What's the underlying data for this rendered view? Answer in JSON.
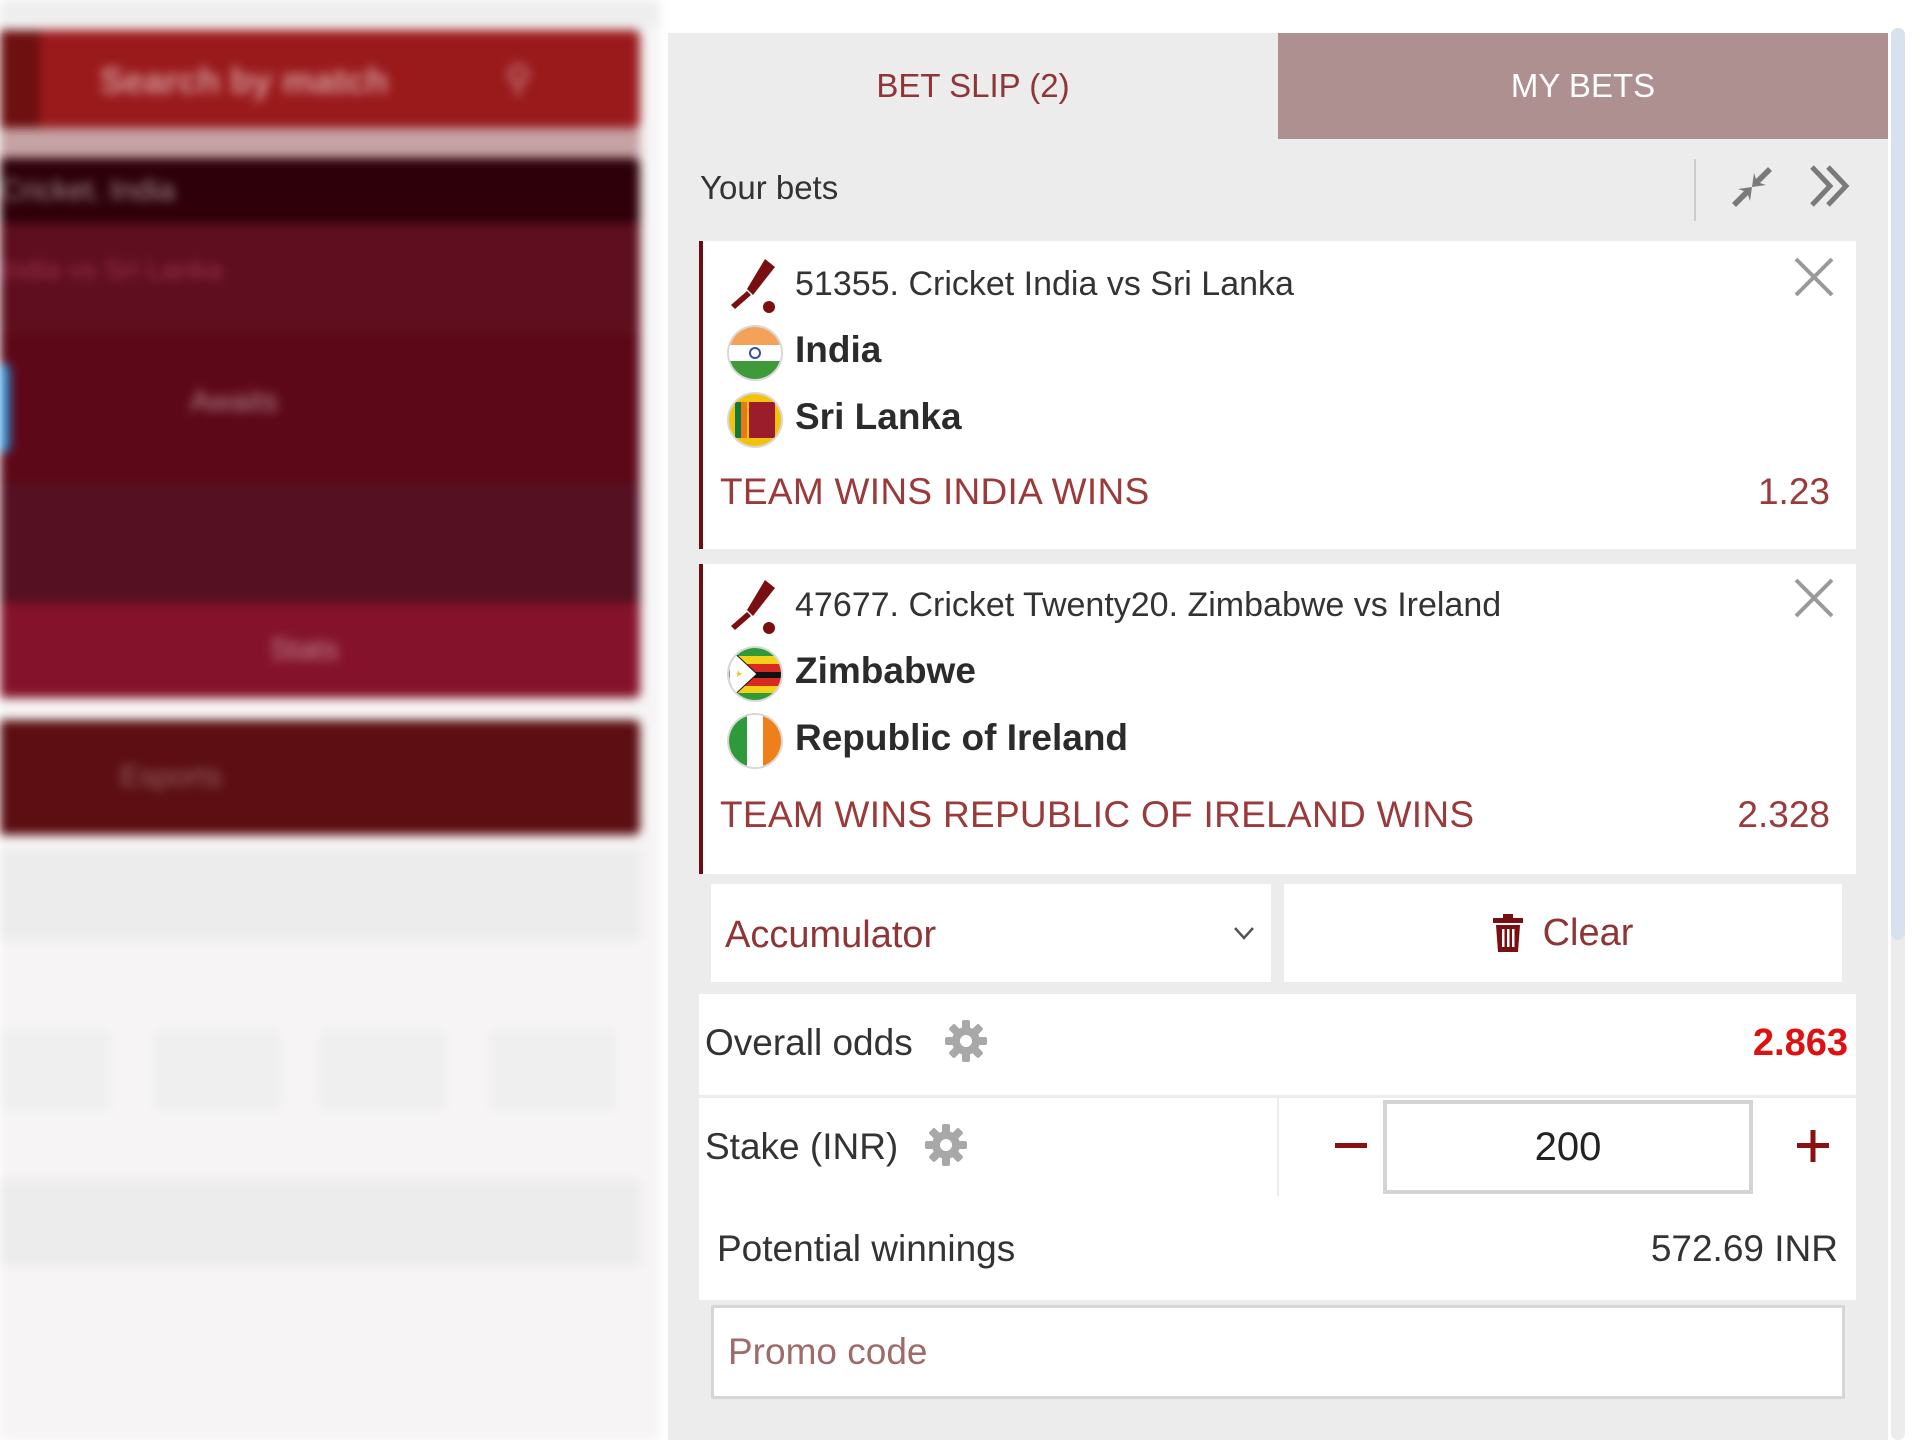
{
  "background": {
    "search_placeholder": "Search by match",
    "match_header": "Cricket. India",
    "match_sub": "India vs Sri Lanka",
    "match_center": "Awaits",
    "match_footer": "Stats",
    "nav_item": "Esports"
  },
  "tabs": [
    {
      "label": "BET SLIP (2)",
      "active": true
    },
    {
      "label": "MY BETS",
      "active": false
    }
  ],
  "your_bets": {
    "label": "Your bets",
    "icons": [
      "compress-icon",
      "double-chevron-right-icon"
    ]
  },
  "bets": [
    {
      "sport_icon": "cricket-icon",
      "title": "51355. Cricket India vs Sri Lanka",
      "teams": [
        {
          "name": "India",
          "flag": "india-flag"
        },
        {
          "name": "Sri Lanka",
          "flag": "sri-lanka-flag"
        }
      ],
      "market": "TEAM WINS INDIA WINS",
      "odds": "1.23"
    },
    {
      "sport_icon": "cricket-icon",
      "title": "47677. Cricket Twenty20. Zimbabwe vs Ireland",
      "teams": [
        {
          "name": "Zimbabwe",
          "flag": "zimbabwe-flag"
        },
        {
          "name": "Republic of Ireland",
          "flag": "ireland-flag"
        }
      ],
      "market": "TEAM WINS REPUBLIC OF IRELAND WINS",
      "odds": "2.328"
    }
  ],
  "controls": {
    "bet_type": "Accumulator",
    "clear_label": "Clear"
  },
  "summary": {
    "overall_odds_label": "Overall odds",
    "overall_odds_value": "2.863",
    "stake_label": "Stake (INR)",
    "stake_value": "200",
    "potential_winnings_label": "Potential winnings",
    "potential_winnings_value": "572.69 INR",
    "promo_placeholder": "Promo code"
  },
  "colors": {
    "brand": "#8e3538",
    "accent_dark": "#6e0d0f",
    "tab_inactive_bg": "#ae9090",
    "odds_total": "#dd1111"
  }
}
